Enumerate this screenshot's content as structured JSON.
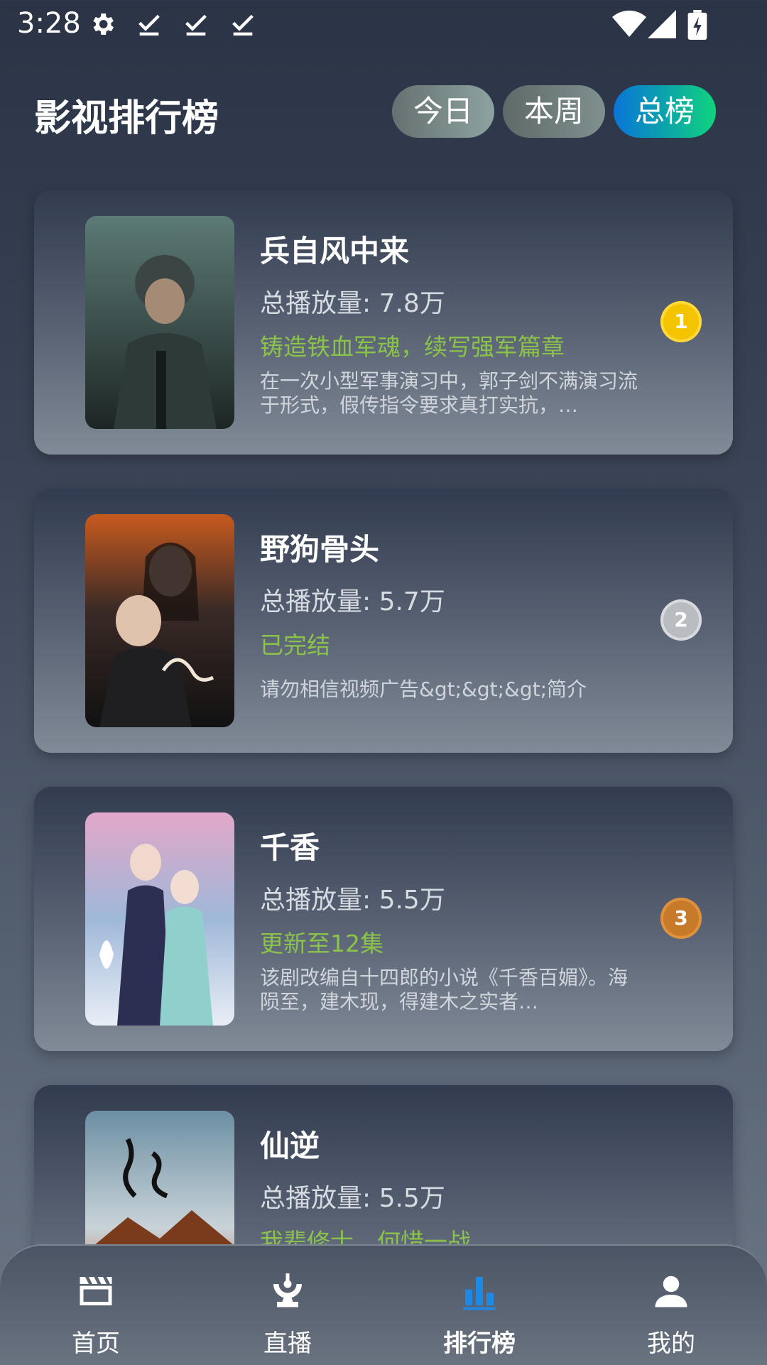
{
  "status_bar": {
    "time": "3:28",
    "icons": [
      "gear-icon",
      "download-done-icon",
      "download-done-icon",
      "download-done-icon",
      "wifi-icon",
      "signal-icon",
      "battery-charging-icon"
    ]
  },
  "header": {
    "title": "影视排行榜",
    "tabs": [
      {
        "label": "今日",
        "active": false
      },
      {
        "label": "本周",
        "active": false
      },
      {
        "label": "总榜",
        "active": true
      }
    ]
  },
  "list": [
    {
      "title": "兵自风中来",
      "plays": "总播放量: 7.8万",
      "tag": "铸造铁血军魂，续写强军篇章",
      "desc": "在一次小型军事演习中，郭子剑不满演习流于形式，假传指令要求真打实抗，…",
      "rank": "1",
      "rank_color": "#f5c400"
    },
    {
      "title": "野狗骨头",
      "plays": "总播放量: 5.7万",
      "tag": "已完结",
      "desc": "请勿相信视频广告&gt;&gt;&gt;简介",
      "rank": "2",
      "rank_color": "#b9bcc0"
    },
    {
      "title": "千香",
      "plays": "总播放量: 5.5万",
      "tag": "更新至12集",
      "desc": "该剧改编自十四郎的小说《千香百媚》。海陨至，建木现，得建木之实者…",
      "rank": "3",
      "rank_color": "#c77a2a"
    },
    {
      "title": "仙逆",
      "plays": "总播放量: 5.5万",
      "tag": "我辈修士，何惜一战",
      "desc": ""
    }
  ],
  "bottom_nav": [
    {
      "label": "首页",
      "icon": "clapperboard-icon",
      "active": false
    },
    {
      "label": "直播",
      "icon": "live-antenna-icon",
      "active": false
    },
    {
      "label": "排行榜",
      "icon": "bar-chart-icon",
      "active": true
    },
    {
      "label": "我的",
      "icon": "person-icon",
      "active": false
    }
  ],
  "colors": {
    "accent": "#1e88e5",
    "tag_green": "#8bc34a",
    "tab_active_start": "#0a74d8",
    "tab_active_end": "#0fd37e"
  }
}
